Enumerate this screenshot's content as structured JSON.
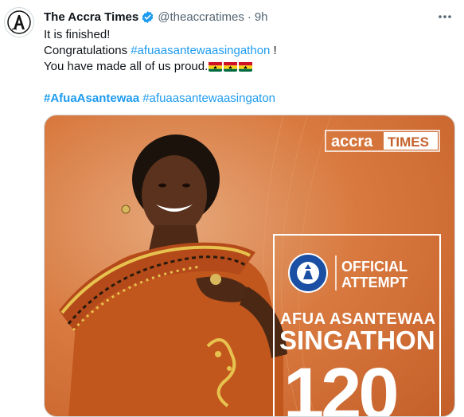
{
  "tweet": {
    "author_name": "The Accra Times",
    "handle": "@theaccratimes",
    "separator": "·",
    "time": "9h",
    "lines": {
      "l1": "It is finished!",
      "l2_prefix": "Congratulations ",
      "l2_tag": "#afuaasantewaasingathon",
      "l2_suffix": " !",
      "l3": "You have made all of us proud.",
      "l4_tag1": "#AfuaAsantewaa",
      "l4_tag2": "#afuaasantewaasingaton"
    }
  },
  "media": {
    "brand_logo_text": "accra TIMES",
    "record_text": "OFFICIAL ATTEMPT",
    "name_line1": "AFUA ASANTEWAA",
    "name_line2": "SINGATHON",
    "number": "120"
  },
  "colors": {
    "link": "#1d9bf0",
    "verified": "#1d9bf0",
    "poster_orange": "#d8793f"
  },
  "icons": {
    "verified": "verified-badge-icon",
    "more": "more-icon",
    "flag": "ghana-flag-icon"
  }
}
